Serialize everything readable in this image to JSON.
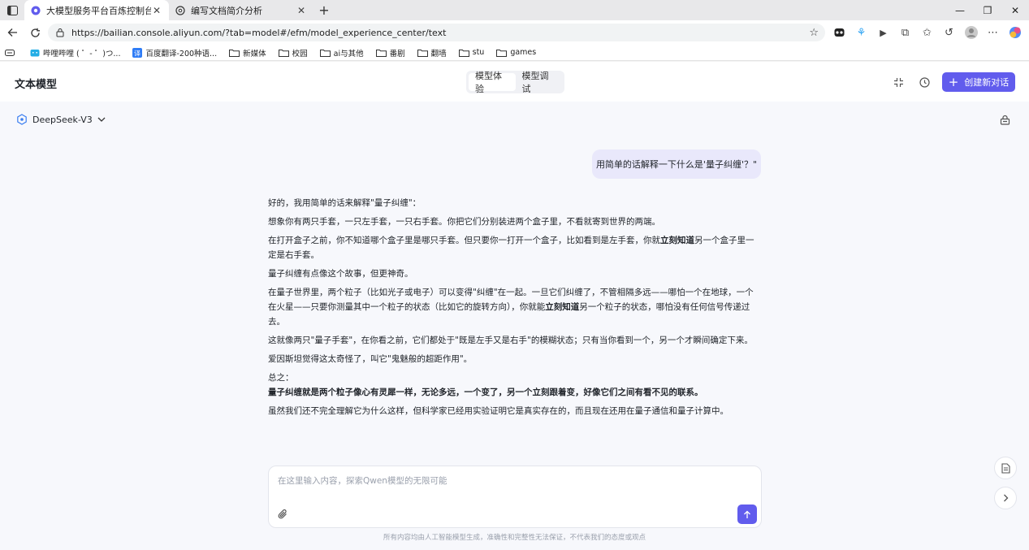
{
  "browser": {
    "tabs": [
      {
        "title": "大模型服务平台百炼控制台",
        "active": true
      },
      {
        "title": "编写文档简介分析",
        "active": false
      }
    ],
    "url": "https://bailian.console.aliyun.com/?tab=model#/efm/model_experience_center/text",
    "bookmarks": [
      "哔哩哔哩 ( ゜- ゜)つ...",
      "百度翻译-200种语...",
      "新媒体",
      "校园",
      "ai与其他",
      "番剧",
      "翻墙",
      "stu",
      "games"
    ]
  },
  "header": {
    "title": "文本模型",
    "tabs": [
      {
        "label": "模型体验",
        "active": true
      },
      {
        "label": "模型调试",
        "active": false
      }
    ],
    "new_chat_label": "创建新对话"
  },
  "model": {
    "name": "DeepSeek-V3"
  },
  "chat": {
    "user_message": "用简单的话解释一下什么是'量子纠缠'？\"",
    "reply": {
      "p1": "好的，我用简单的话来解释\"量子纠缠\"：",
      "p2": "想象你有两只手套，一只左手套，一只右手套。你把它们分别装进两个盒子里，不看就寄到世界的两端。",
      "p3a": "在打开盒子之前，你不知道哪个盒子里是哪只手套。但只要你一打开一个盒子，比如看到是左手套，你就",
      "p3b": "立刻知道",
      "p3c": "另一个盒子里一定是右手套。",
      "p4": "量子纠缠有点像这个故事，但更神奇。",
      "p5a": "在量子世界里，两个粒子（比如光子或电子）可以变得\"纠缠\"在一起。一旦它们纠缠了，不管相隔多远——哪怕一个在地球，一个在火星——只要你测量其中一个粒子的状态（比如它的旋转方向），你就能",
      "p5b": "立刻知道",
      "p5c": "另一个粒子的状态，哪怕没有任何信号传递过去。",
      "p6": "这就像两只\"量子手套\"，在你看之前，它们都处于\"既是左手又是右手\"的模糊状态；只有当你看到一个，另一个才瞬间确定下来。",
      "p7": "爱因斯坦觉得这太奇怪了，叫它\"鬼魅般的超距作用\"。",
      "p8": "总之：",
      "p9": "量子纠缠就是两个粒子像心有灵犀一样，无论多远，一个变了，另一个立刻跟着变，好像它们之间有看不见的联系。",
      "p10": "虽然我们还不完全理解它为什么这样，但科学家已经用实验证明它是真实存在的，而且现在还用在量子通信和量子计算中。"
    }
  },
  "input": {
    "placeholder": "在这里输入内容，探索Qwen模型的无限可能"
  },
  "footer": {
    "disclaimer": "所有内容均由人工智能模型生成，准确性和完整性无法保证，不代表我们的态度或观点"
  },
  "colors": {
    "accent": "#615ced",
    "user_bubble": "#e9e8fb",
    "chat_bg": "#f7f8fc"
  }
}
